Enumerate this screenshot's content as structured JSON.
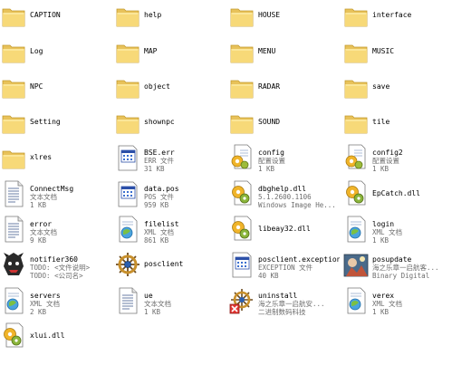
{
  "items": [
    {
      "name": "CAPTION",
      "icon": "folder-icon"
    },
    {
      "name": "help",
      "icon": "folder-icon"
    },
    {
      "name": "HOUSE",
      "icon": "folder-icon"
    },
    {
      "name": "interface",
      "icon": "folder-icon"
    },
    {
      "name": "Log",
      "icon": "folder-icon"
    },
    {
      "name": "MAP",
      "icon": "folder-icon"
    },
    {
      "name": "MENU",
      "icon": "folder-icon"
    },
    {
      "name": "MUSIC",
      "icon": "folder-icon"
    },
    {
      "name": "NPC",
      "icon": "folder-icon"
    },
    {
      "name": "object",
      "icon": "folder-icon"
    },
    {
      "name": "RADAR",
      "icon": "folder-icon"
    },
    {
      "name": "save",
      "icon": "folder-icon"
    },
    {
      "name": "Setting",
      "icon": "folder-icon"
    },
    {
      "name": "shownpc",
      "icon": "folder-icon"
    },
    {
      "name": "SOUND",
      "icon": "folder-icon"
    },
    {
      "name": "tile",
      "icon": "folder-icon"
    },
    {
      "name": "xlres",
      "icon": "folder-icon"
    },
    {
      "name": "BSE.err",
      "line2": "ERR 文件",
      "line3": "31 KB",
      "icon": "window-file-icon"
    },
    {
      "name": "config",
      "line2": "配置设置",
      "line3": "1 KB",
      "icon": "settings-file-icon"
    },
    {
      "name": "config2",
      "line2": "配置设置",
      "line3": "1 KB",
      "icon": "settings-file-icon"
    },
    {
      "name": "ConnectMsg",
      "line2": "文本文档",
      "line3": "1 KB",
      "icon": "text-document-icon"
    },
    {
      "name": "data.pos",
      "line2": "POS 文件",
      "line3": "959 KB",
      "icon": "window-file-icon"
    },
    {
      "name": "dbghelp.dll",
      "line2": "5.1.2600.1106",
      "line3": "Windows Image He...",
      "icon": "dll-gear-icon"
    },
    {
      "name": "EpCatch.dll",
      "icon": "dll-gear-icon"
    },
    {
      "name": "error",
      "line2": "文本文档",
      "line3": "9 KB",
      "icon": "text-document-icon"
    },
    {
      "name": "filelist",
      "line2": "XML 文档",
      "line3": "861 KB",
      "icon": "xml-document-icon"
    },
    {
      "name": "libeay32.dll",
      "icon": "dll-gear-icon"
    },
    {
      "name": "login",
      "line2": "XML 文档",
      "line3": "1 KB",
      "icon": "xml-document-icon"
    },
    {
      "name": "notifier360",
      "line2": "TODO: <文件说明>",
      "line3": "TODO: <公司名>",
      "icon": "creature-app-icon"
    },
    {
      "name": "posclient",
      "icon": "ship-wheel-icon"
    },
    {
      "name": "posclient.exception",
      "line2": "EXCEPTION 文件",
      "line3": "40 KB",
      "icon": "window-file-icon"
    },
    {
      "name": "posupdate",
      "line2": "海之乐章一启航客...",
      "line3": "Binary Digital",
      "icon": "photo-app-icon"
    },
    {
      "name": "servers",
      "line2": "XML 文档",
      "line3": "2 KB",
      "icon": "xml-document-icon"
    },
    {
      "name": "ue",
      "line2": "文本文档",
      "line3": "1 KB",
      "icon": "text-document-icon"
    },
    {
      "name": "uninstall",
      "line2": "海之乐章一启航安...",
      "line3": "二进制数码科技",
      "icon": "uninstall-icon"
    },
    {
      "name": "verex",
      "line2": "XML 文档",
      "line3": "1 KB",
      "icon": "xml-document-icon"
    },
    {
      "name": "xlui.dll",
      "icon": "dll-gear-icon"
    }
  ]
}
